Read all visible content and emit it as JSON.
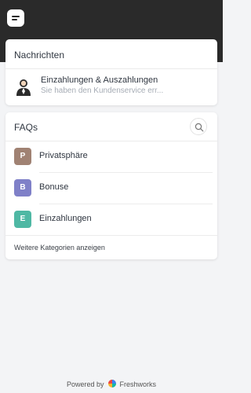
{
  "header": {
    "logo_icon": "chat-bubble-icon",
    "background": "#2a2a2a"
  },
  "messages": {
    "title": "Nachrichten",
    "item": {
      "title": "Einzahlungen & Auszahlungen",
      "preview": "Sie haben den Kundenservice err...",
      "avatar_icon": "support-agent-icon"
    }
  },
  "faqs": {
    "title": "FAQs",
    "search_icon": "search-icon",
    "categories": [
      {
        "letter": "P",
        "label": "Privatsphäre",
        "color": "#a08273"
      },
      {
        "letter": "B",
        "label": "Bonuse",
        "color": "#7f80c8"
      },
      {
        "letter": "E",
        "label": "Einzahlungen",
        "color": "#4fb8a4"
      }
    ],
    "more_link": "Weitere Kategorien anzeigen"
  },
  "footer": {
    "powered_by": "Powered by",
    "brand": "Freshworks"
  }
}
